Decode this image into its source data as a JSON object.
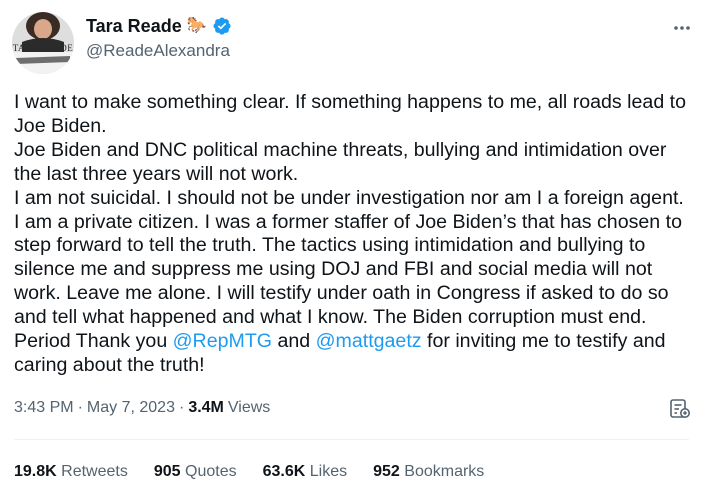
{
  "author": {
    "display_name": "Tara Reade",
    "emoji": "🐎",
    "handle": "@ReadeAlexandra",
    "avatar_caption": "TARA READE",
    "verified_color": "#1d9bf0"
  },
  "tweet": {
    "text_1": "I want to make something clear. If something happens to me, all roads lead to Joe Biden.\nJoe Biden and DNC political machine threats, bullying and intimidation over the last three years will not work.\nI am not suicidal. I should not be under investigation nor am I a foreign agent. I am a private citizen. I was a former staffer of Joe Biden’s that has chosen to step forward to tell the truth. The tactics using intimidation and bullying to silence me and suppress me using DOJ and FBI and social media will not work. Leave me alone. I will testify under oath in Congress if asked to do so and tell what happened and what I know. The Biden corruption must end. Period Thank you ",
    "mention_1": "@RepMTG",
    "text_2": " and ",
    "mention_2": "@mattgaetz",
    "text_3": " for inviting me to testify and caring about the truth!",
    "mention_color": "#1d9bf0"
  },
  "meta": {
    "time": "3:43 PM",
    "separator": "·",
    "date": "May 7, 2023",
    "views_count": "3.4M",
    "views_label": "Views"
  },
  "stats": {
    "retweets_count": "19.8K",
    "retweets_label": "Retweets",
    "quotes_count": "905",
    "quotes_label": "Quotes",
    "likes_count": "63.6K",
    "likes_label": "Likes",
    "bookmarks_count": "952",
    "bookmarks_label": "Bookmarks"
  },
  "icons": {
    "more": "more-horizontal-icon",
    "verified": "verified-badge-icon",
    "analytics": "analytics-icon"
  }
}
